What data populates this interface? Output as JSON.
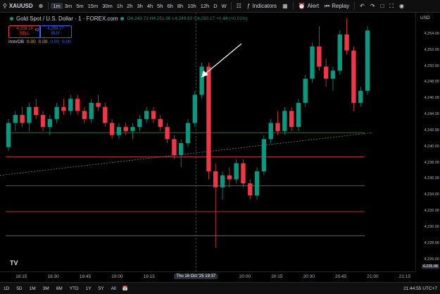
{
  "toolbar": {
    "symbol": "XAUUSD",
    "timeframes": [
      "1m",
      "3m",
      "5m",
      "15m",
      "30m",
      "1h",
      "2h",
      "3h",
      "4h",
      "5h",
      "6h",
      "8h",
      "10h",
      "12h",
      "D",
      "W"
    ],
    "active_timeframe": "1m",
    "indicators_label": "Indicators",
    "alert_label": "Alert",
    "replay_label": "Replay"
  },
  "legend": {
    "title": "Gold Spot / U.S. Dollar · 1 · FOREX.com",
    "ohlc": "O4,249.73 H4,251.06 L4,249.62 C4,250.17 +0.44 (+0.01%)",
    "sell_price": "4,259.14",
    "sell_label": "SELL",
    "buy_price": "4,259.77",
    "buy_label": "BUY",
    "spread": "62",
    "indicator_name": "Imb/OB",
    "indicator_values": [
      "0.00",
      "0.00",
      "0.00",
      "0.00"
    ]
  },
  "yaxis": {
    "currency": "USD",
    "ticks": [
      "4,254.00",
      "4,252.00",
      "4,250.00",
      "4,248.00",
      "4,246.00",
      "4,244.00",
      "4,242.00",
      "4,240.00",
      "4,238.00",
      "4,236.00",
      "4,234.00",
      "4,232.00",
      "4,230.00",
      "4,228.00",
      "4,226.00"
    ],
    "last_price": "4,225.08"
  },
  "xaxis": {
    "ticks": [
      "18:15",
      "18:30",
      "18:45",
      "19:00",
      "19:15",
      "20:00",
      "20:15",
      "20:30",
      "20:45",
      "21:00",
      "21:15"
    ],
    "crosshair_label": "Thu 16 Oct '25   19:37"
  },
  "bottombar": {
    "ranges": [
      "1D",
      "5D",
      "1M",
      "3M",
      "6M",
      "YTD",
      "1Y",
      "5Y",
      "All"
    ],
    "clock": "21:44:55 UTC+7"
  },
  "colors": {
    "up": "#089981",
    "down": "#f23645",
    "bg": "#000000"
  },
  "chart_data": {
    "type": "candlestick",
    "ylim": [
      4225,
      4256
    ],
    "x_range": [
      "18:05",
      "21:20"
    ],
    "horizontal_levels": [
      {
        "value": 4241.8,
        "color": "#4caf50"
      },
      {
        "value": 4238.8,
        "color": "#f23645"
      },
      {
        "value": 4235.2,
        "color": "#4caf50"
      },
      {
        "value": 4232.0,
        "color": "#f23645"
      },
      {
        "value": 4229.0,
        "color": "#888888"
      }
    ],
    "trendline": {
      "from": [
        "18:05",
        4236.5
      ],
      "to": [
        "21:00",
        4241.8
      ]
    },
    "crosshair_time": "19:37",
    "candles": [
      {
        "o": 4240.0,
        "h": 4243.5,
        "l": 4239.5,
        "c": 4243.0
      },
      {
        "o": 4243.0,
        "h": 4244.5,
        "l": 4242.0,
        "c": 4244.0
      },
      {
        "o": 4244.0,
        "h": 4245.0,
        "l": 4242.5,
        "c": 4243.0
      },
      {
        "o": 4243.0,
        "h": 4245.5,
        "l": 4242.0,
        "c": 4245.0
      },
      {
        "o": 4245.0,
        "h": 4246.0,
        "l": 4243.5,
        "c": 4244.0
      },
      {
        "o": 4244.0,
        "h": 4244.5,
        "l": 4242.0,
        "c": 4242.5
      },
      {
        "o": 4242.5,
        "h": 4244.0,
        "l": 4241.5,
        "c": 4243.5
      },
      {
        "o": 4243.5,
        "h": 4245.5,
        "l": 4243.0,
        "c": 4245.0
      },
      {
        "o": 4245.0,
        "h": 4246.0,
        "l": 4244.0,
        "c": 4244.5
      },
      {
        "o": 4244.5,
        "h": 4246.5,
        "l": 4244.0,
        "c": 4246.0
      },
      {
        "o": 4246.0,
        "h": 4246.5,
        "l": 4244.0,
        "c": 4244.5
      },
      {
        "o": 4244.5,
        "h": 4245.0,
        "l": 4243.0,
        "c": 4243.5
      },
      {
        "o": 4243.5,
        "h": 4246.0,
        "l": 4243.0,
        "c": 4245.5
      },
      {
        "o": 4245.5,
        "h": 4246.5,
        "l": 4244.5,
        "c": 4245.0
      },
      {
        "o": 4245.0,
        "h": 4245.5,
        "l": 4242.5,
        "c": 4243.0
      },
      {
        "o": 4243.0,
        "h": 4243.5,
        "l": 4241.0,
        "c": 4241.5
      },
      {
        "o": 4241.5,
        "h": 4243.0,
        "l": 4241.0,
        "c": 4242.5
      },
      {
        "o": 4242.5,
        "h": 4243.0,
        "l": 4241.5,
        "c": 4242.0
      },
      {
        "o": 4242.0,
        "h": 4243.0,
        "l": 4241.0,
        "c": 4242.5
      },
      {
        "o": 4242.5,
        "h": 4244.0,
        "l": 4242.0,
        "c": 4243.5
      },
      {
        "o": 4243.5,
        "h": 4245.0,
        "l": 4243.0,
        "c": 4244.5
      },
      {
        "o": 4244.5,
        "h": 4245.0,
        "l": 4243.0,
        "c": 4243.5
      },
      {
        "o": 4243.5,
        "h": 4244.0,
        "l": 4242.0,
        "c": 4242.5
      },
      {
        "o": 4242.5,
        "h": 4243.0,
        "l": 4240.5,
        "c": 4241.0
      },
      {
        "o": 4241.0,
        "h": 4241.5,
        "l": 4238.5,
        "c": 4239.0
      },
      {
        "o": 4239.0,
        "h": 4241.0,
        "l": 4237.5,
        "c": 4240.5
      },
      {
        "o": 4240.5,
        "h": 4243.5,
        "l": 4240.0,
        "c": 4243.0
      },
      {
        "o": 4243.0,
        "h": 4247.0,
        "l": 4242.5,
        "c": 4246.5
      },
      {
        "o": 4246.5,
        "h": 4250.5,
        "l": 4246.0,
        "c": 4250.0
      },
      {
        "o": 4250.0,
        "h": 4250.5,
        "l": 4236.0,
        "c": 4237.0
      },
      {
        "o": 4237.0,
        "h": 4238.0,
        "l": 4227.5,
        "c": 4235.0
      },
      {
        "o": 4235.0,
        "h": 4237.0,
        "l": 4233.5,
        "c": 4236.5
      },
      {
        "o": 4236.5,
        "h": 4237.5,
        "l": 4235.0,
        "c": 4236.0
      },
      {
        "o": 4236.0,
        "h": 4238.5,
        "l": 4235.5,
        "c": 4238.0
      },
      {
        "o": 4238.0,
        "h": 4238.5,
        "l": 4235.0,
        "c": 4235.5
      },
      {
        "o": 4235.5,
        "h": 4236.0,
        "l": 4233.5,
        "c": 4234.0
      },
      {
        "o": 4234.0,
        "h": 4237.5,
        "l": 4233.5,
        "c": 4237.0
      },
      {
        "o": 4237.0,
        "h": 4241.5,
        "l": 4236.5,
        "c": 4241.0
      },
      {
        "o": 4241.0,
        "h": 4243.5,
        "l": 4240.5,
        "c": 4243.0
      },
      {
        "o": 4243.0,
        "h": 4244.5,
        "l": 4241.5,
        "c": 4242.0
      },
      {
        "o": 4242.0,
        "h": 4245.0,
        "l": 4241.5,
        "c": 4244.5
      },
      {
        "o": 4244.5,
        "h": 4245.0,
        "l": 4242.0,
        "c": 4242.5
      },
      {
        "o": 4242.5,
        "h": 4246.0,
        "l": 4242.0,
        "c": 4245.5
      },
      {
        "o": 4245.5,
        "h": 4249.0,
        "l": 4245.0,
        "c": 4248.5
      },
      {
        "o": 4248.5,
        "h": 4253.0,
        "l": 4248.0,
        "c": 4252.5
      },
      {
        "o": 4252.5,
        "h": 4255.0,
        "l": 4249.5,
        "c": 4250.0
      },
      {
        "o": 4250.0,
        "h": 4251.0,
        "l": 4247.5,
        "c": 4248.5
      },
      {
        "o": 4248.5,
        "h": 4250.0,
        "l": 4247.0,
        "c": 4249.5
      },
      {
        "o": 4249.5,
        "h": 4254.5,
        "l": 4249.0,
        "c": 4254.0
      },
      {
        "o": 4254.0,
        "h": 4256.0,
        "l": 4251.5,
        "c": 4252.0
      },
      {
        "o": 4252.0,
        "h": 4252.5,
        "l": 4244.5,
        "c": 4245.5
      },
      {
        "o": 4245.5,
        "h": 4247.5,
        "l": 4245.0,
        "c": 4247.0
      },
      {
        "o": 4247.0,
        "h": 4255.0,
        "l": 4246.5,
        "c": 4254.5
      }
    ]
  }
}
